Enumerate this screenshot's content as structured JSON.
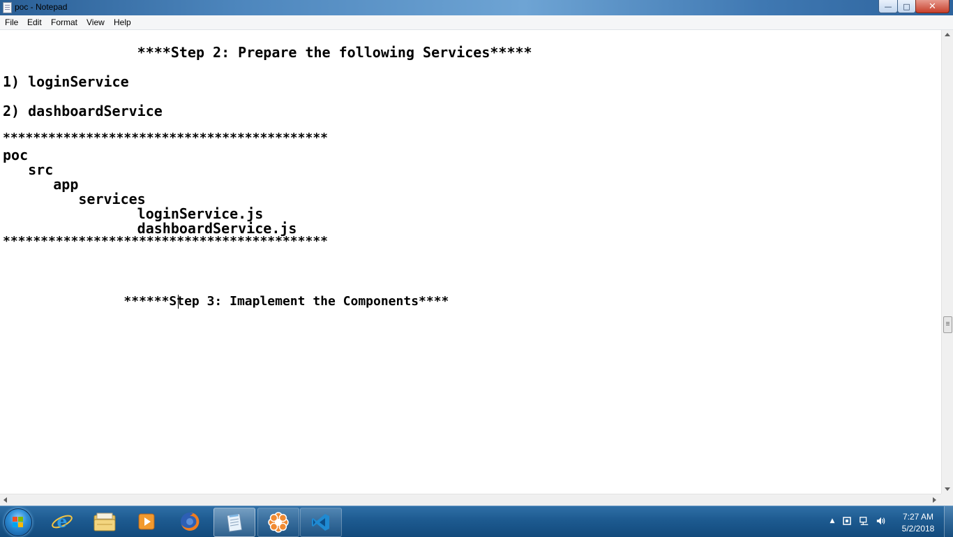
{
  "window": {
    "title": "poc - Notepad",
    "controls": {
      "minimize": "—",
      "maximize": "□",
      "close": "✕"
    }
  },
  "menu": [
    "File",
    "Edit",
    "Format",
    "View",
    "Help"
  ],
  "editor": {
    "lines": [
      "                ****Step 2: Prepare the following Services*****",
      "1) loginService",
      "2) dashboardService",
      "*******************************************",
      "poc",
      "   src",
      "      app",
      "         services",
      "                loginService.js",
      "                dashboardService.js",
      "*******************************************",
      "                ******Step 3: Imaplement the Components****"
    ]
  },
  "taskbar": {
    "apps": [
      {
        "name": "internet-explorer-icon",
        "state": "normal"
      },
      {
        "name": "file-explorer-icon",
        "state": "normal"
      },
      {
        "name": "media-player-icon",
        "state": "normal"
      },
      {
        "name": "firefox-icon",
        "state": "normal"
      },
      {
        "name": "notepad-icon",
        "state": "active"
      },
      {
        "name": "flower-app-icon",
        "state": "open"
      },
      {
        "name": "vscode-icon",
        "state": "open"
      }
    ],
    "tray": {
      "time": "7:27 AM",
      "date": "5/2/2018"
    }
  },
  "colors": {
    "titlebar": "#4d86bd",
    "taskbar": "#1d5a90",
    "close_button": "#c7402b"
  }
}
